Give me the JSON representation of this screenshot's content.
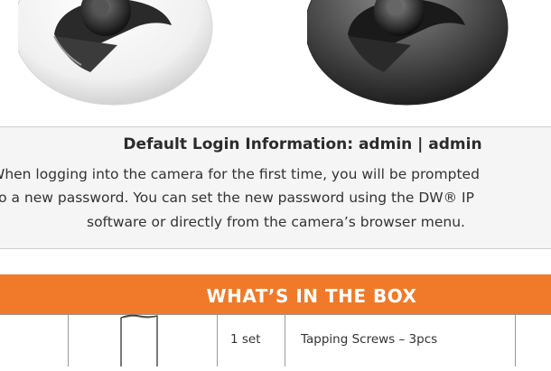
{
  "login": {
    "title": "Default Login Information: admin | admin",
    "line1": "When logging into the camera for the first time, you will be prompted",
    "line2": "to a new password. You can set the new password using the DW® IP",
    "line3": "software or directly from the camera’s browser menu."
  },
  "box": {
    "header": "WHAT’S IN THE BOX",
    "rows": [
      {
        "quantity": "1 set",
        "item": "Tapping Screws – 3pcs"
      }
    ]
  },
  "colors": {
    "accent_orange": "#f07a2a",
    "login_background": "#f5f5f5"
  },
  "icons": [
    "white-dome-camera-image",
    "black-dome-camera-image",
    "manual-booklet-icon"
  ]
}
